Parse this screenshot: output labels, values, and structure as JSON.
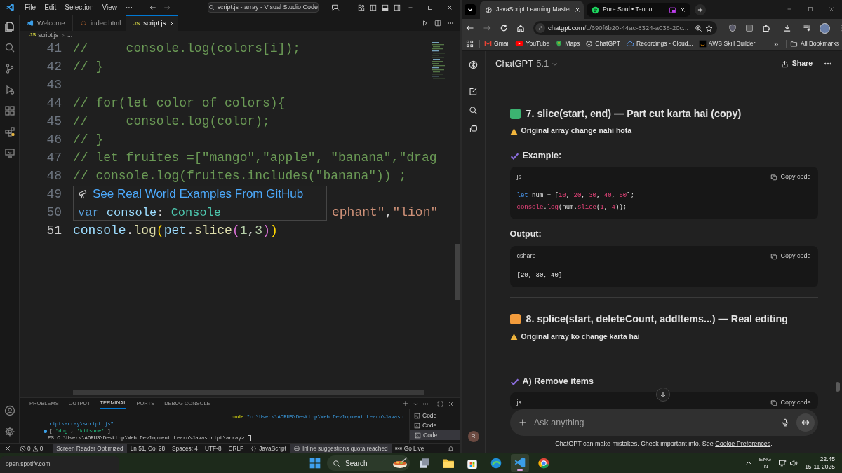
{
  "vscode": {
    "menu": [
      "File",
      "Edit",
      "Selection",
      "View",
      "···"
    ],
    "command_center": "script.js - array - Visual Studio Code",
    "tabs": [
      {
        "label": "Welcome",
        "kind": "welcome",
        "selected": false
      },
      {
        "label": "indec.html",
        "kind": "html",
        "selected": false
      },
      {
        "label": "script.js",
        "kind": "js",
        "badge": "JS",
        "selected": true
      }
    ],
    "breadcrumb": {
      "badge": "JS",
      "file": "script.js",
      "rest": "..."
    },
    "lines": [
      {
        "number": "41",
        "tokens": [
          {
            "text": "//     console.log(colors[i]);",
            "kind": "comment"
          }
        ]
      },
      {
        "number": "42",
        "tokens": [
          {
            "text": "// }",
            "kind": "comment"
          }
        ]
      },
      {
        "number": "43"
      },
      {
        "number": "44",
        "tokens": [
          {
            "text": "// for(let color of colors){",
            "kind": "comment"
          }
        ]
      },
      {
        "number": "45",
        "tokens": [
          {
            "text": "//     console.log(color);",
            "kind": "comment"
          }
        ]
      },
      {
        "number": "46",
        "tokens": [
          {
            "text": "// }",
            "kind": "comment"
          }
        ]
      },
      {
        "number": "47",
        "tokens": [
          {
            "text": "// let fruites =[\"mango\",\"apple\", \"banana\",\"drag",
            "kind": "comment"
          }
        ]
      },
      {
        "number": "48",
        "tokens": [
          {
            "text": "// console.log(fruites.includes(\"banana\")) ;",
            "kind": "comment"
          }
        ]
      },
      {
        "number": "49"
      },
      {
        "number": "50",
        "behind_popup": true,
        "tokens": [
          {
            "text": "ephant\"",
            "kind": "string"
          },
          {
            "text": ",",
            "kind": "plain"
          },
          {
            "text": "\"lion\"",
            "kind": "string"
          }
        ]
      },
      {
        "number": "51",
        "behind_popup": false,
        "tokens": [
          {
            "text": "console",
            "kind": "variable"
          },
          {
            "text": ".",
            "kind": "plain"
          },
          {
            "text": "log",
            "kind": "function"
          },
          {
            "text": "(",
            "kind": "bracket1"
          },
          {
            "text": "pet",
            "kind": "variable"
          },
          {
            "text": ".",
            "kind": "plain"
          },
          {
            "text": "slice",
            "kind": "function"
          },
          {
            "text": "(",
            "kind": "bracket2"
          },
          {
            "text": "1",
            "kind": "number"
          },
          {
            "text": ",",
            "kind": "plain"
          },
          {
            "text": "3",
            "kind": "number"
          },
          {
            "text": ")",
            "kind": "bracket2"
          },
          {
            "text": ")",
            "kind": "bracket1"
          }
        ]
      }
    ],
    "hover": {
      "link": "See Real World Examples From GitHub",
      "signature": [
        {
          "text": "var ",
          "kind": "keyword"
        },
        {
          "text": "console",
          "kind": "variable"
        },
        {
          "text": ": ",
          "kind": "plain"
        },
        {
          "text": "Console",
          "kind": "type"
        }
      ]
    },
    "panel_tabs": [
      {
        "label": "PROBLEMS",
        "selected": false
      },
      {
        "label": "OUTPUT",
        "selected": false
      },
      {
        "label": "TERMINAL",
        "selected": true
      },
      {
        "label": "PORTS",
        "selected": false
      },
      {
        "label": "DEBUG CONSOLE",
        "selected": false
      }
    ],
    "terminal_lines": [
      {
        "kind": "wrapped_command",
        "tokens": [
          {
            "text": "node",
            "kind": "command"
          },
          {
            "text": " \"c:\\Users\\AORUS\\Desktop\\Web Devlopment Learn\\Javasc",
            "kind": "path"
          }
        ]
      },
      {
        "kind": "continuation",
        "tokens": [
          {
            "text": "ript\\array\\script.js\"",
            "kind": "path"
          }
        ]
      },
      {
        "kind": "output",
        "tokens": [
          {
            "text": "[ ",
            "kind": "plain"
          },
          {
            "text": "'dog'",
            "kind": "string"
          },
          {
            "text": ", ",
            "kind": "plain"
          },
          {
            "text": "'kitsune'",
            "kind": "string"
          },
          {
            "text": " ]",
            "kind": "plain"
          }
        ]
      },
      {
        "kind": "prompt",
        "tokens": [
          {
            "text": "PS C:\\Users\\AORUS\\Desktop\\Web Devlopment Learn\\Javascript\\array> ",
            "kind": "plain"
          }
        ]
      }
    ],
    "terminals": [
      {
        "label": "Code",
        "selected": false
      },
      {
        "label": "Code",
        "selected": false
      },
      {
        "label": "Code",
        "selected": true
      }
    ],
    "status": {
      "errors": "0",
      "warnings": "0",
      "items": [
        {
          "text": "Screen Reader Optimized",
          "kind": "plain",
          "highlighted": true
        },
        {
          "text": "Ln 51, Col 28",
          "kind": "plain",
          "highlighted": false
        },
        {
          "text": "Spaces: 4",
          "kind": "plain",
          "highlighted": false
        },
        {
          "text": "UTF-8",
          "kind": "plain",
          "highlighted": false
        },
        {
          "text": "CRLF",
          "kind": "plain",
          "highlighted": false
        },
        {
          "text": "JavaScript",
          "kind": "language",
          "highlighted": false
        },
        {
          "text": "Inline suggestions quota reached",
          "kind": "copilot",
          "highlighted": true
        },
        {
          "text": "Go Live",
          "kind": "golive",
          "highlighted": false
        }
      ]
    }
  },
  "chrome": {
    "tabs": [
      {
        "title": "JavaScript Learning Master",
        "kind": "chatgpt",
        "selected": true
      },
      {
        "title": "Pure Soul • Tenno",
        "kind": "spotify",
        "selected": false,
        "pip": true
      }
    ],
    "url_host": "chatgpt.com",
    "url_path": "/c/690f6b20-44ac-8324-a038-20c...",
    "bookmarks": [
      {
        "label": "Gmail",
        "kind": "gmail"
      },
      {
        "label": "YouTube",
        "kind": "youtube"
      },
      {
        "label": "Maps",
        "kind": "maps"
      },
      {
        "label": "ChatGPT",
        "kind": "chatgpt"
      },
      {
        "label": "Recordings - Cloud...",
        "kind": "cloud"
      },
      {
        "label": "AWS Skill Builder",
        "kind": "aws"
      }
    ],
    "more_bookmarks": "»",
    "all_bookmarks": "All Bookmarks"
  },
  "chatgpt": {
    "model": "ChatGPT",
    "version": "5.1",
    "share": "Share",
    "content": [
      {
        "kind": "divider"
      },
      {
        "kind": "heading",
        "color": "#3cb371",
        "text": "7. slice(start, end) — Part cut karta hai (copy)"
      },
      {
        "kind": "warning",
        "text": "Original array change nahi hota"
      },
      {
        "kind": "check",
        "text": "Example:"
      },
      {
        "kind": "code",
        "language": "js",
        "copy": "Copy code",
        "lines": [
          [
            {
              "text": "let",
              "kind": "keyword"
            },
            {
              "text": " num = [",
              "kind": "plain"
            },
            {
              "text": "10",
              "kind": "number"
            },
            {
              "text": ", ",
              "kind": "plain"
            },
            {
              "text": "20",
              "kind": "number"
            },
            {
              "text": ", ",
              "kind": "plain"
            },
            {
              "text": "30",
              "kind": "number"
            },
            {
              "text": ", ",
              "kind": "plain"
            },
            {
              "text": "40",
              "kind": "number"
            },
            {
              "text": ", ",
              "kind": "plain"
            },
            {
              "text": "50",
              "kind": "number"
            },
            {
              "text": "];",
              "kind": "plain"
            }
          ],
          [
            {
              "text": "console",
              "kind": "function"
            },
            {
              "text": ".",
              "kind": "plain"
            },
            {
              "text": "log",
              "kind": "function"
            },
            {
              "text": "(num.",
              "kind": "plain"
            },
            {
              "text": "slice",
              "kind": "function"
            },
            {
              "text": "(",
              "kind": "plain"
            },
            {
              "text": "1",
              "kind": "number"
            },
            {
              "text": ", ",
              "kind": "plain"
            },
            {
              "text": "4",
              "kind": "number"
            },
            {
              "text": "));",
              "kind": "plain"
            }
          ]
        ]
      },
      {
        "kind": "label",
        "text": "Output:"
      },
      {
        "kind": "code",
        "language": "csharp",
        "copy": "Copy code",
        "lines": [
          [
            {
              "text": "[20, 30, 40]",
              "kind": "plain"
            }
          ]
        ]
      },
      {
        "kind": "divider"
      },
      {
        "kind": "heading",
        "color": "#f39c3c",
        "text": "8. splice(start, deleteCount, addItems...) — Real editing"
      },
      {
        "kind": "warning",
        "text": "Original array ko change karta hai"
      },
      {
        "kind": "divider"
      },
      {
        "kind": "check",
        "text": "A) Remove items"
      },
      {
        "kind": "code",
        "language": "js",
        "copy": "Copy code"
      }
    ],
    "placeholder": "Ask anything",
    "avatar": "R",
    "footer": {
      "before": "ChatGPT can make mistakes. Check important info. See ",
      "link": "Cookie Preferences",
      "after": "."
    }
  },
  "taskbar": {
    "preview_label": "open.spotify.com",
    "search": "Search",
    "apps": [
      {
        "kind": "taskview",
        "active": false
      },
      {
        "kind": "explorer",
        "active": false
      },
      {
        "kind": "store",
        "active": false
      },
      {
        "kind": "edge",
        "active": false
      },
      {
        "kind": "vscode",
        "active": true
      },
      {
        "kind": "chrome",
        "active": false
      }
    ],
    "language": "ENG",
    "region": "IN",
    "time": "22:45",
    "date": "15-11-2025"
  }
}
